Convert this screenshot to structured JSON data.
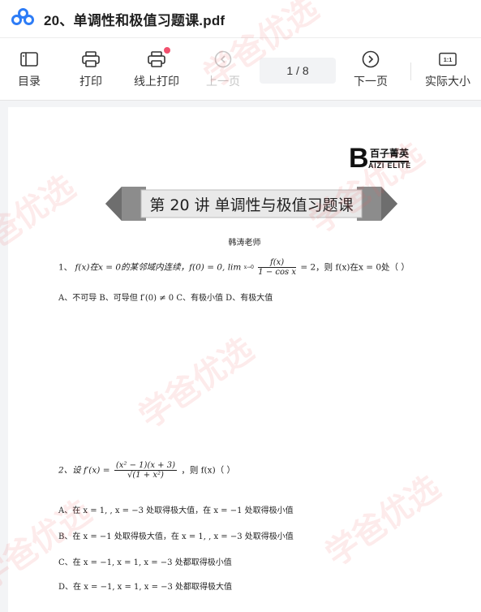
{
  "titlebar": {
    "logo_icon": "cloud-link-icon",
    "title": "20、单调性和极值习题课.pdf"
  },
  "toolbar": {
    "toc_label": "目录",
    "print_label": "打印",
    "online_print_label": "线上打印",
    "prev_label": "上一页",
    "page_indicator": "1  / 8",
    "next_label": "下一页",
    "actual_size_label": "实际大小",
    "actual_size_icon_text": "1:1"
  },
  "document": {
    "brand_cn": "百子菁英",
    "brand_en": "AIZI ELITE",
    "brand_letter": "B",
    "banner_title": "第 20 讲  单调性与极值习题课",
    "teacher": "韩涛老师",
    "q1": {
      "prefix": "1、",
      "part1": "f(x)在x = 0的某邻域内连续，f(0) = 0, lim",
      "lim_sub": "x→0",
      "frac_num": "f(x)",
      "frac_den": "1 − cos x",
      "part2": "= 2，则 f(x)在x = 0处（    ）",
      "options": "A、不可导    B、可导但 f′(0) ≠ 0    C、有极小值    D、有极大值"
    },
    "q2": {
      "prefix": "2、设 f′(x) =",
      "frac_num": "(x² − 1)(x + 3)",
      "frac_den": "√(1 + x²)",
      "suffix": "，则 f(x)（    ）",
      "opt_a": "A、在 x = 1, , x = −3 处取得极大值，在 x = −1 处取得极小值",
      "opt_b": "B、在 x = −1 处取得极大值，在 x = 1, , x = −3 处取得极小值",
      "opt_c": "C、在 x = −1, x = 1, x = −3 处都取得极小值",
      "opt_d": "D、在 x = −1, x = 1, x = −3 处都取得极大值"
    },
    "watermark_text": "学爸优选"
  },
  "colors": {
    "accent": "#2d7cf6",
    "notification": "#f2506e",
    "watermark": "#eb5a5a"
  }
}
